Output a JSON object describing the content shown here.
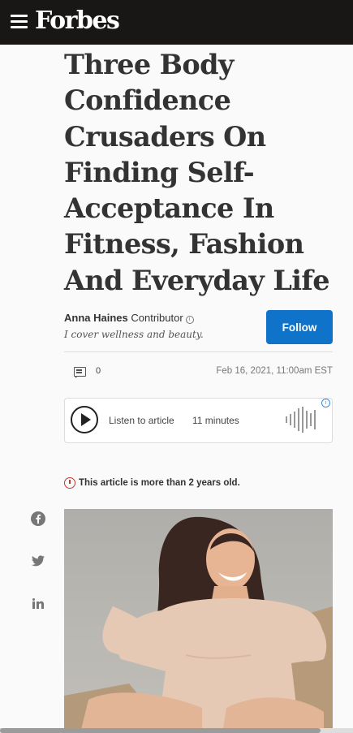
{
  "header": {
    "logo": "Forbes"
  },
  "article": {
    "title": "Three Body Confidence Crusaders On Finding Self-Acceptance In Fitness, Fashion And Everyday Life",
    "author_name": "Anna Haines",
    "author_role": "Contributor",
    "author_bio": "I cover wellness and beauty.",
    "follow_label": "Follow",
    "comment_count": "0",
    "date": "Feb 16, 2021, 11:00am EST",
    "age_notice": "This article is more than 2 years old."
  },
  "audio_player": {
    "listen_label": "Listen to article",
    "duration": "11 minutes"
  },
  "social": [
    "facebook-icon",
    "twitter-icon",
    "linkedin-icon"
  ]
}
